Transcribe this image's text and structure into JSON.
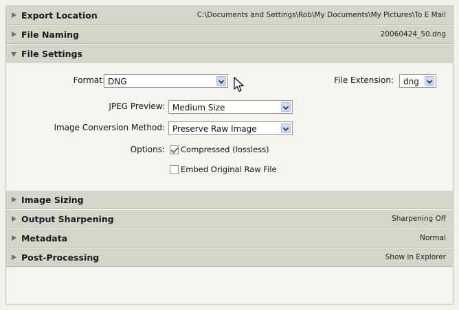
{
  "sections": {
    "export_location": {
      "title": "Export Location",
      "summary": "C:\\Documents and Settings\\Rob\\My Documents\\My Pictures\\To E Mail"
    },
    "file_naming": {
      "title": "File Naming",
      "summary": "20060424_50.dng"
    },
    "file_settings": {
      "title": "File Settings"
    },
    "image_sizing": {
      "title": "Image Sizing"
    },
    "output_sharpening": {
      "title": "Output Sharpening",
      "summary": "Sharpening Off"
    },
    "metadata": {
      "title": "Metadata",
      "summary": "Normal"
    },
    "post_processing": {
      "title": "Post-Processing",
      "summary": "Show in Explorer"
    }
  },
  "file_settings": {
    "format_label": "Format:",
    "format_value": "DNG",
    "extension_label": "File Extension:",
    "extension_value": "dng",
    "jpeg_preview_label": "JPEG Preview:",
    "jpeg_preview_value": "Medium Size",
    "conversion_label": "Image Conversion Method:",
    "conversion_value": "Preserve Raw Image",
    "options_label": "Options:",
    "compressed_label": "Compressed (lossless)",
    "compressed_checked": true,
    "embed_label": "Embed Original Raw File",
    "embed_checked": false
  },
  "icons": {
    "collapsed": "triangle-right-icon",
    "expanded": "triangle-down-icon",
    "dropdown": "chevron-down-icon",
    "cursor": "mouse-pointer-icon"
  }
}
